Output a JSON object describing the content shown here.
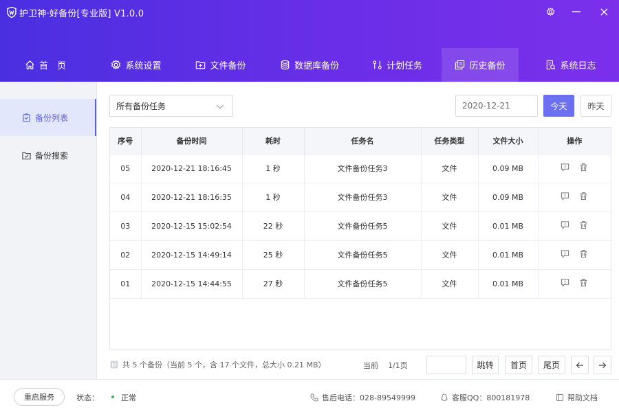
{
  "app": {
    "title": "护卫神·好备份[专业版]  V1.0.0"
  },
  "nav": [
    {
      "label": "首　页",
      "icon": "home-icon"
    },
    {
      "label": "系统设置",
      "icon": "gear-icon"
    },
    {
      "label": "文件备份",
      "icon": "folder-plus-icon"
    },
    {
      "label": "数据库备份",
      "icon": "database-icon"
    },
    {
      "label": "计划任务",
      "icon": "schedule-icon"
    },
    {
      "label": "历史备份",
      "icon": "copy-icon"
    },
    {
      "label": "系统日志",
      "icon": "log-icon"
    }
  ],
  "nav_active": "历史备份",
  "sidebar": [
    {
      "label": "备份列表",
      "icon": "list-icon"
    },
    {
      "label": "备份搜索",
      "icon": "search-folder-icon"
    }
  ],
  "filter": {
    "task_select": "所有备份任务",
    "date": "2020-12-21",
    "today_label": "今天",
    "yesterday_label": "昨天"
  },
  "table": {
    "headers": [
      "序号",
      "备份时间",
      "耗时",
      "任务名",
      "任务类型",
      "文件大小",
      "操作"
    ],
    "rows": [
      [
        "05",
        "2020-12-21 18:16:45",
        "1 秒",
        "文件备份任务3",
        "文件",
        "0.09 MB"
      ],
      [
        "04",
        "2020-12-21 18:16:35",
        "1 秒",
        "文件备份任务3",
        "文件",
        "0.09 MB"
      ],
      [
        "03",
        "2020-12-15 15:02:54",
        "22 秒",
        "文件备份任务5",
        "文件",
        "0.01 MB"
      ],
      [
        "02",
        "2020-12-15 14:49:14",
        "25 秒",
        "文件备份任务5",
        "文件",
        "0.01 MB"
      ],
      [
        "01",
        "2020-12-15 14:44:55",
        "27 秒",
        "文件备份任务5",
        "文件",
        "0.01 MB"
      ]
    ]
  },
  "pagination": {
    "summary": "共 5 个备份（当前 5 个，含 17 个文件，总大小 0.21 MB）",
    "current_label": "当前",
    "current_page": "1/1页",
    "jump_label": "跳转",
    "first_label": "首页",
    "last_label": "尾页"
  },
  "footer": {
    "restart_label": "重启服务",
    "status_label": "状态：",
    "status_value": "正常",
    "phone": "售后电话：028-89549999",
    "qq": "客服QQ：800181978",
    "help": "帮助文档"
  },
  "colors": {
    "header_start": "#4a2fe0",
    "header_end": "#7b30ea",
    "accent": "#6b6ff0",
    "status_ok": "#39b54a"
  }
}
